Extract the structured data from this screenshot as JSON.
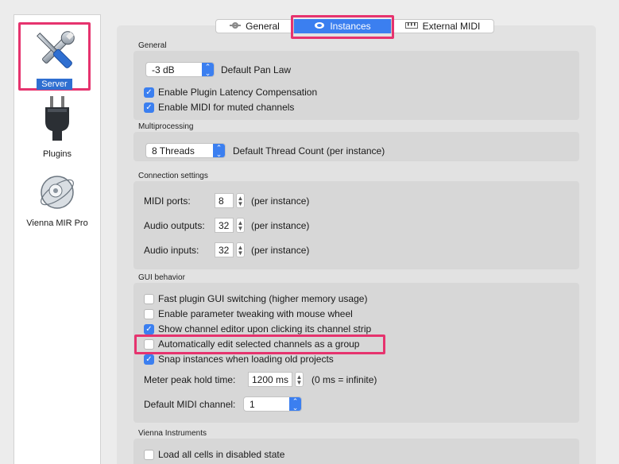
{
  "sidebar": {
    "items": [
      {
        "label": "Server",
        "icon": "server-tools-icon",
        "selected": true
      },
      {
        "label": "Plugins",
        "icon": "plug-icon"
      },
      {
        "label": "Vienna MIR Pro",
        "icon": "vienna-mir-icon"
      }
    ]
  },
  "tabs": [
    {
      "label": "General",
      "icon": "gear-icon"
    },
    {
      "label": "Instances",
      "icon": "instances-icon",
      "selected": true
    },
    {
      "label": "External MIDI",
      "icon": "keyboard-icon"
    }
  ],
  "general": {
    "title": "General",
    "pan_law_value": "-3 dB",
    "pan_law_label": "Default Pan Law",
    "latency_label": "Enable Plugin Latency Compensation",
    "latency_checked": true,
    "midi_muted_label": "Enable MIDI for muted channels",
    "midi_muted_checked": true
  },
  "multiprocessing": {
    "title": "Multiprocessing",
    "threads_value": "8 Threads",
    "threads_label": "Default Thread Count (per instance)"
  },
  "connection": {
    "title": "Connection settings",
    "rows": [
      {
        "label": "MIDI ports:",
        "value": "8",
        "suffix": "(per instance)"
      },
      {
        "label": "Audio outputs:",
        "value": "32",
        "suffix": "(per instance)"
      },
      {
        "label": "Audio inputs:",
        "value": "32",
        "suffix": "(per instance)"
      }
    ]
  },
  "gui": {
    "title": "GUI behavior",
    "options": [
      {
        "label": "Fast plugin GUI switching (higher memory usage)",
        "checked": false
      },
      {
        "label": "Enable parameter tweaking with mouse wheel",
        "checked": false
      },
      {
        "label": "Show channel editor upon clicking its channel strip",
        "checked": true
      },
      {
        "label": "Automatically edit selected channels as a group",
        "checked": false
      },
      {
        "label": "Snap instances when loading old projects",
        "checked": true
      }
    ],
    "meter_label": "Meter peak hold time:",
    "meter_value": "1200 ms",
    "meter_suffix": "(0 ms = infinite)",
    "midi_channel_label": "Default MIDI channel:",
    "midi_channel_value": "1"
  },
  "vienna": {
    "title": "Vienna Instruments",
    "load_cells_label": "Load all cells in disabled state",
    "load_cells_checked": false
  },
  "colors": {
    "accent": "#3b7ff0",
    "highlight": "#e6336e"
  }
}
